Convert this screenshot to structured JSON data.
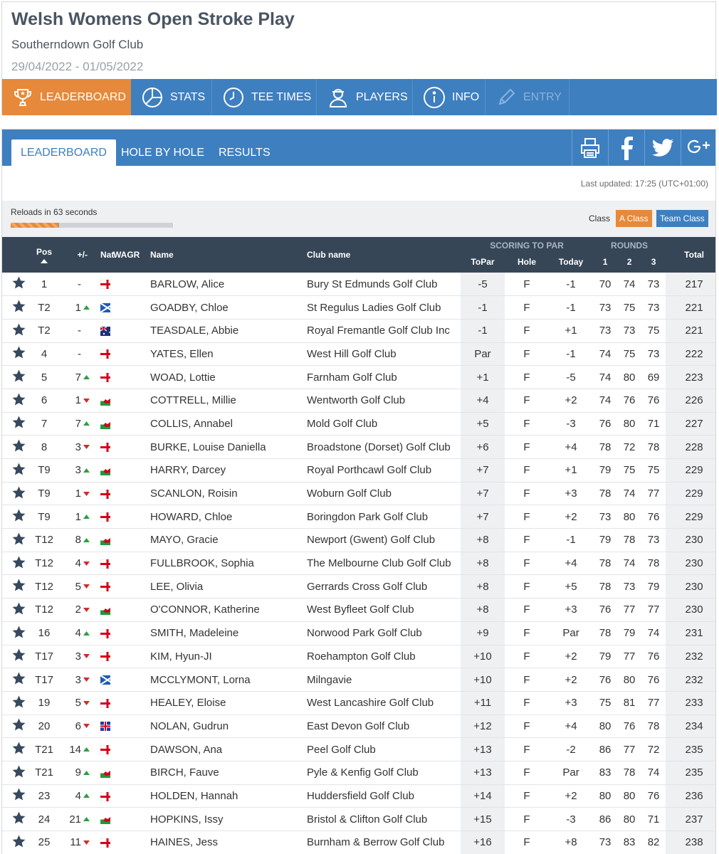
{
  "header": {
    "title": "Welsh Womens Open Stroke Play",
    "venue": "Southerndown Golf Club",
    "dates": "29/04/2022 - 01/05/2022"
  },
  "main_nav": [
    {
      "label": "LEADERBOARD",
      "icon": "trophy-icon",
      "active": true
    },
    {
      "label": "STATS",
      "icon": "pie-chart-icon"
    },
    {
      "label": "TEE TIMES",
      "icon": "clock-icon"
    },
    {
      "label": "PLAYERS",
      "icon": "player-icon"
    },
    {
      "label": "INFO",
      "icon": "info-icon"
    },
    {
      "label": "ENTRY",
      "icon": "pencil-icon",
      "disabled": true
    }
  ],
  "sub_nav": {
    "tabs": [
      "LEADERBOARD",
      "HOLE BY HOLE",
      "RESULTS"
    ],
    "share": [
      "print-icon",
      "facebook-icon",
      "twitter-icon",
      "google-plus-icon"
    ]
  },
  "status": {
    "last_updated": "Last updated: 17:25 (UTC+01:00)",
    "reload": "Reloads in 63 seconds",
    "reload_progress_percent": 30,
    "class_label": "Class",
    "class_buttons": [
      "A Class",
      "Team Class"
    ]
  },
  "colors": {
    "nav_blue": "#3e7fc0",
    "active_orange": "#e6893a",
    "header_dark": "#374657",
    "up_green": "#2e9e3f",
    "down_red": "#d12b2b"
  },
  "table": {
    "columns": {
      "pos": "Pos",
      "move": "+/-",
      "nat": "Nat",
      "wagr": "WAGR",
      "name": "Name",
      "club": "Club name",
      "scoring_group": "SCORING TO PAR",
      "topar": "ToPar",
      "hole": "Hole",
      "today": "Today",
      "rounds_group": "ROUNDS",
      "r1": "1",
      "r2": "2",
      "r3": "3",
      "total": "Total"
    },
    "rows": [
      {
        "pos": "1",
        "move": "-",
        "dir": "",
        "nat": "ENG",
        "name": "BARLOW, Alice",
        "club": "Bury St Edmunds Golf Club",
        "topar": "-5",
        "hole": "F",
        "today": "-1",
        "r1": "70",
        "r2": "74",
        "r3": "73",
        "total": "217"
      },
      {
        "pos": "T2",
        "move": "1",
        "dir": "up",
        "nat": "SCO",
        "name": "GOADBY, Chloe",
        "club": "St Regulus Ladies Golf Club",
        "topar": "-1",
        "hole": "F",
        "today": "-1",
        "r1": "73",
        "r2": "75",
        "r3": "73",
        "total": "221"
      },
      {
        "pos": "T2",
        "move": "-",
        "dir": "",
        "nat": "AUS",
        "name": "TEASDALE, Abbie",
        "club": "Royal Fremantle Golf Club Inc",
        "topar": "-1",
        "hole": "F",
        "today": "+1",
        "r1": "73",
        "r2": "73",
        "r3": "75",
        "total": "221"
      },
      {
        "pos": "4",
        "move": "-",
        "dir": "",
        "nat": "ENG",
        "name": "YATES, Ellen",
        "club": "West Hill Golf Club",
        "topar": "Par",
        "hole": "F",
        "today": "-1",
        "r1": "74",
        "r2": "75",
        "r3": "73",
        "total": "222"
      },
      {
        "pos": "5",
        "move": "7",
        "dir": "up",
        "nat": "ENG",
        "name": "WOAD, Lottie",
        "club": "Farnham Golf Club",
        "topar": "+1",
        "hole": "F",
        "today": "-5",
        "r1": "74",
        "r2": "80",
        "r3": "69",
        "total": "223"
      },
      {
        "pos": "6",
        "move": "1",
        "dir": "down",
        "nat": "WAL",
        "name": "COTTRELL, Millie",
        "club": "Wentworth Golf Club",
        "topar": "+4",
        "hole": "F",
        "today": "+2",
        "r1": "74",
        "r2": "76",
        "r3": "76",
        "total": "226"
      },
      {
        "pos": "7",
        "move": "7",
        "dir": "up",
        "nat": "WAL",
        "name": "COLLIS, Annabel",
        "club": "Mold Golf Club",
        "topar": "+5",
        "hole": "F",
        "today": "-3",
        "r1": "76",
        "r2": "80",
        "r3": "71",
        "total": "227"
      },
      {
        "pos": "8",
        "move": "3",
        "dir": "down",
        "nat": "ENG",
        "name": "BURKE, Louise Daniella",
        "club": "Broadstone (Dorset) Golf Club",
        "topar": "+6",
        "hole": "F",
        "today": "+4",
        "r1": "78",
        "r2": "72",
        "r3": "78",
        "total": "228"
      },
      {
        "pos": "T9",
        "move": "3",
        "dir": "up",
        "nat": "WAL",
        "name": "HARRY, Darcey",
        "club": "Royal Porthcawl Golf Club",
        "topar": "+7",
        "hole": "F",
        "today": "+1",
        "r1": "79",
        "r2": "75",
        "r3": "75",
        "total": "229"
      },
      {
        "pos": "T9",
        "move": "1",
        "dir": "down",
        "nat": "ENG",
        "name": "SCANLON, Roisin",
        "club": "Woburn Golf Club",
        "topar": "+7",
        "hole": "F",
        "today": "+3",
        "r1": "78",
        "r2": "74",
        "r3": "77",
        "total": "229"
      },
      {
        "pos": "T9",
        "move": "1",
        "dir": "up",
        "nat": "ENG",
        "name": "HOWARD, Chloe",
        "club": "Boringdon Park Golf Club",
        "topar": "+7",
        "hole": "F",
        "today": "+2",
        "r1": "73",
        "r2": "80",
        "r3": "76",
        "total": "229"
      },
      {
        "pos": "T12",
        "move": "8",
        "dir": "up",
        "nat": "WAL",
        "name": "MAYO, Gracie",
        "club": "Newport (Gwent) Golf Club",
        "topar": "+8",
        "hole": "F",
        "today": "-1",
        "r1": "79",
        "r2": "78",
        "r3": "73",
        "total": "230"
      },
      {
        "pos": "T12",
        "move": "4",
        "dir": "down",
        "nat": "ENG",
        "name": "FULLBROOK, Sophia",
        "club": "The Melbourne Club Golf Club",
        "topar": "+8",
        "hole": "F",
        "today": "+4",
        "r1": "78",
        "r2": "74",
        "r3": "78",
        "total": "230"
      },
      {
        "pos": "T12",
        "move": "5",
        "dir": "down",
        "nat": "ENG",
        "name": "LEE, Olivia",
        "club": "Gerrards Cross Golf Club",
        "topar": "+8",
        "hole": "F",
        "today": "+5",
        "r1": "78",
        "r2": "73",
        "r3": "79",
        "total": "230"
      },
      {
        "pos": "T12",
        "move": "2",
        "dir": "down",
        "nat": "WAL",
        "name": "O'CONNOR, Katherine",
        "club": "West Byfleet Golf Club",
        "topar": "+8",
        "hole": "F",
        "today": "+3",
        "r1": "76",
        "r2": "77",
        "r3": "77",
        "total": "230"
      },
      {
        "pos": "16",
        "move": "4",
        "dir": "up",
        "nat": "ENG",
        "name": "SMITH, Madeleine",
        "club": "Norwood Park Golf Club",
        "topar": "+9",
        "hole": "F",
        "today": "Par",
        "r1": "78",
        "r2": "79",
        "r3": "74",
        "total": "231"
      },
      {
        "pos": "T17",
        "move": "3",
        "dir": "down",
        "nat": "ENG",
        "name": "KIM, Hyun-JI",
        "club": "Roehampton Golf Club",
        "topar": "+10",
        "hole": "F",
        "today": "+2",
        "r1": "79",
        "r2": "77",
        "r3": "76",
        "total": "232"
      },
      {
        "pos": "T17",
        "move": "3",
        "dir": "down",
        "nat": "SCO",
        "name": "MCCLYMONT, Lorna",
        "club": "Milngavie",
        "topar": "+10",
        "hole": "F",
        "today": "+2",
        "r1": "76",
        "r2": "80",
        "r3": "76",
        "total": "232"
      },
      {
        "pos": "19",
        "move": "5",
        "dir": "down",
        "nat": "ENG",
        "name": "HEALEY, Eloise",
        "club": "West Lancashire Golf Club",
        "topar": "+11",
        "hole": "F",
        "today": "+3",
        "r1": "75",
        "r2": "81",
        "r3": "77",
        "total": "233"
      },
      {
        "pos": "20",
        "move": "6",
        "dir": "down",
        "nat": "ISL",
        "name": "NOLAN, Gudrun",
        "club": "East Devon Golf Club",
        "topar": "+12",
        "hole": "F",
        "today": "+4",
        "r1": "80",
        "r2": "76",
        "r3": "78",
        "total": "234"
      },
      {
        "pos": "T21",
        "move": "14",
        "dir": "up",
        "nat": "ENG",
        "name": "DAWSON, Ana",
        "club": "Peel Golf Club",
        "topar": "+13",
        "hole": "F",
        "today": "-2",
        "r1": "86",
        "r2": "77",
        "r3": "72",
        "total": "235"
      },
      {
        "pos": "T21",
        "move": "9",
        "dir": "up",
        "nat": "WAL",
        "name": "BIRCH, Fauve",
        "club": "Pyle & Kenfig Golf Club",
        "topar": "+13",
        "hole": "F",
        "today": "Par",
        "r1": "83",
        "r2": "78",
        "r3": "74",
        "total": "235"
      },
      {
        "pos": "23",
        "move": "4",
        "dir": "up",
        "nat": "ENG",
        "name": "HOLDEN, Hannah",
        "club": "Huddersfield Golf Club",
        "topar": "+14",
        "hole": "F",
        "today": "+2",
        "r1": "80",
        "r2": "80",
        "r3": "76",
        "total": "236"
      },
      {
        "pos": "24",
        "move": "21",
        "dir": "up",
        "nat": "WAL",
        "name": "HOPKINS, Issy",
        "club": "Bristol & Clifton Golf Club",
        "topar": "+15",
        "hole": "F",
        "today": "-3",
        "r1": "86",
        "r2": "80",
        "r3": "71",
        "total": "237"
      },
      {
        "pos": "25",
        "move": "11",
        "dir": "down",
        "nat": "ENG",
        "name": "HAINES, Jess",
        "club": "Burnham & Berrow Golf Club",
        "topar": "+16",
        "hole": "F",
        "today": "+8",
        "r1": "73",
        "r2": "83",
        "r3": "82",
        "total": "238"
      }
    ]
  }
}
